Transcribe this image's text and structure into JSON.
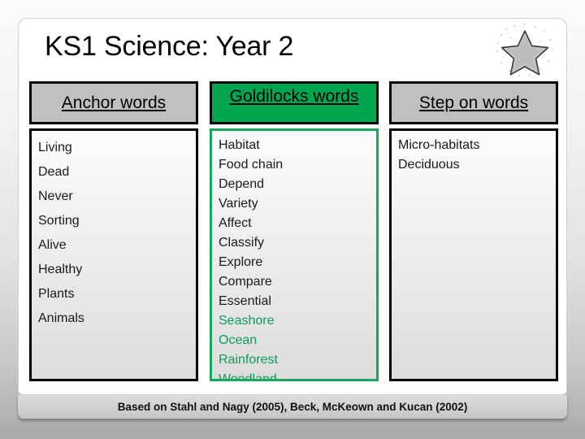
{
  "slide": {
    "title": "KS1 Science: Year 2",
    "decoration_icon": "star-icon",
    "footer": "Based on Stahl and Nagy (2005), Beck, McKeown and Kucan (2002)"
  },
  "colors": {
    "goldilocks_header_bg": "#00a550",
    "goldilocks_border": "#17a85c",
    "plain_header_bg": "#c0c0c0",
    "tier_three_word_text": "#0e9c58",
    "page_background": "#ffffff"
  },
  "columns": [
    {
      "header": "Anchor words",
      "header_style": "gray",
      "words": [
        {
          "text": "Living",
          "highlight": false
        },
        {
          "text": "Dead",
          "highlight": false
        },
        {
          "text": "Never",
          "highlight": false
        },
        {
          "text": "Sorting",
          "highlight": false
        },
        {
          "text": "Alive",
          "highlight": false
        },
        {
          "text": "Healthy",
          "highlight": false
        },
        {
          "text": "Plants",
          "highlight": false
        },
        {
          "text": "Animals",
          "highlight": false
        }
      ]
    },
    {
      "header": "Goldilocks words",
      "header_style": "green",
      "words": [
        {
          "text": "Habitat",
          "highlight": false
        },
        {
          "text": "Food chain",
          "highlight": false
        },
        {
          "text": "Depend",
          "highlight": false
        },
        {
          "text": "Variety",
          "highlight": false
        },
        {
          "text": "Affect",
          "highlight": false
        },
        {
          "text": "Classify",
          "highlight": false
        },
        {
          "text": "Explore",
          "highlight": false
        },
        {
          "text": "Compare",
          "highlight": false
        },
        {
          "text": "Essential",
          "highlight": false
        },
        {
          "text": "Seashore",
          "highlight": true
        },
        {
          "text": "Ocean",
          "highlight": true
        },
        {
          "text": "Rainforest",
          "highlight": true
        },
        {
          "text": "Woodland",
          "highlight": true
        }
      ]
    },
    {
      "header": "Step on words",
      "header_style": "gray",
      "words": [
        {
          "text": "Micro-habitats",
          "highlight": false
        },
        {
          "text": "Deciduous",
          "highlight": false
        }
      ]
    }
  ]
}
